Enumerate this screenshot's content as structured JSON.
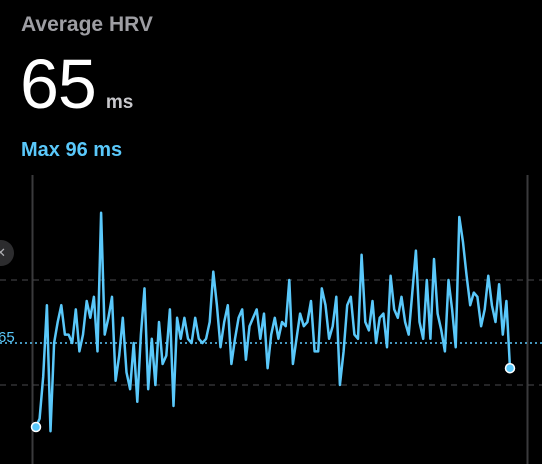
{
  "header": {
    "title": "Average HRV",
    "value": "65",
    "unit": "ms",
    "max_label": "Max 96 ms"
  },
  "reference": {
    "avg_label": "65"
  },
  "colors": {
    "accent": "#5ac8fa",
    "background": "#000000",
    "title_gray": "#9e9ea3"
  },
  "icons": {
    "left_badge": "close-icon"
  },
  "chart_data": {
    "type": "line",
    "title": "",
    "xlabel": "",
    "ylabel": "",
    "y_reference_lines": [
      {
        "value": 80,
        "style": "dashed-gray"
      },
      {
        "value": 65,
        "style": "dotted-accent"
      },
      {
        "value": 55,
        "style": "dashed-gray"
      }
    ],
    "ylim": [
      20,
      100
    ],
    "series": [
      {
        "values": [
          45,
          47,
          57,
          74,
          44,
          65,
          70,
          74,
          67,
          67,
          65,
          73,
          63,
          67,
          75,
          71,
          76,
          63,
          96,
          67,
          71,
          76,
          56,
          62,
          71,
          58,
          54,
          65,
          51,
          67,
          78,
          54,
          66,
          55,
          70,
          60,
          62,
          73,
          50,
          71,
          66,
          71,
          66,
          65,
          71,
          66,
          65,
          66,
          70,
          82,
          74,
          64,
          70,
          74,
          60,
          66,
          71,
          73,
          61,
          69,
          71,
          73,
          66,
          72,
          59,
          67,
          71,
          66,
          70,
          69,
          80,
          60,
          66,
          72,
          69,
          70,
          75,
          63,
          63,
          78,
          74,
          66,
          69,
          76,
          55,
          63,
          74,
          76,
          67,
          66,
          86,
          70,
          68,
          75,
          65,
          71,
          72,
          64,
          81,
          73,
          71,
          76,
          70,
          67,
          77,
          87,
          70,
          66,
          80,
          66,
          85,
          72,
          68,
          63,
          80,
          73,
          64,
          95,
          89,
          81,
          74,
          77,
          76,
          69,
          73,
          81,
          74,
          70,
          79,
          67,
          75,
          59
        ]
      }
    ]
  }
}
